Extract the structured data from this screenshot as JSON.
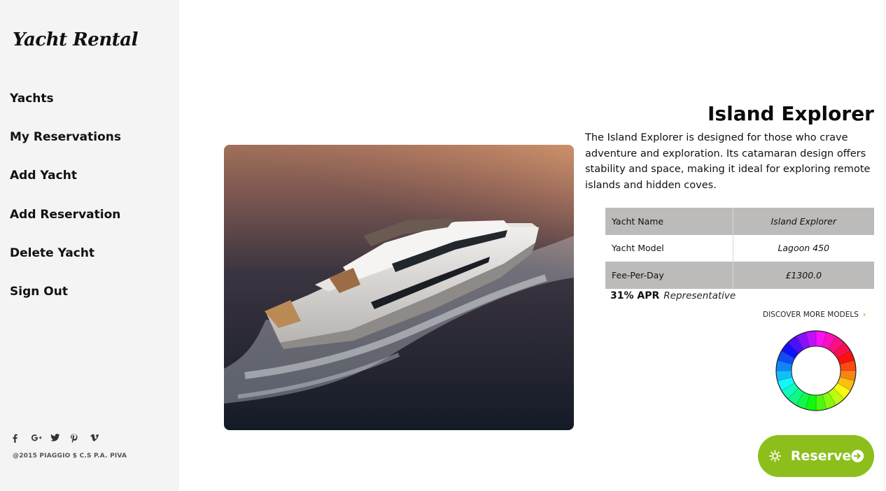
{
  "brand": {
    "logo_text": "Yacht Rental"
  },
  "nav": {
    "items": [
      {
        "label": "Yachts"
      },
      {
        "label": "My Reservations"
      },
      {
        "label": "Add Yacht"
      },
      {
        "label": "Add Reservation"
      },
      {
        "label": "Delete Yacht"
      },
      {
        "label": "Sign Out"
      }
    ]
  },
  "social": {
    "icons": [
      {
        "name": "facebook-icon",
        "glyph": "f"
      },
      {
        "name": "google-plus-icon",
        "glyph": "G+"
      },
      {
        "name": "twitter-icon",
        "glyph": "t"
      },
      {
        "name": "pinterest-icon",
        "glyph": "p"
      },
      {
        "name": "vimeo-icon",
        "glyph": "v"
      }
    ],
    "copyright": "@2015 PIAGGIO $ C.S P.A. PIVA"
  },
  "yacht": {
    "title": "Island Explorer",
    "description": "The Island Explorer is designed for those who crave adventure and exploration. Its catamaran design offers stability and space, making it ideal for exploring remote islands and hidden coves.",
    "image": "yacht-photo",
    "specs": [
      {
        "label": "Yacht Name",
        "value": "Island Explorer"
      },
      {
        "label": "Yacht Model",
        "value": "Lagoon 450"
      },
      {
        "label": "Fee-Per-Day",
        "value": "£1300.0"
      }
    ],
    "apr": {
      "rate": "31% APR",
      "note": "Representative"
    },
    "discover_label": "DISCOVER MORE MODELS",
    "color_wheel_icon": "color-wheel"
  },
  "reserve_button": {
    "label": "Reserve",
    "icon_left": "sun-icon",
    "icon_right": "arrow-circle-right-icon"
  },
  "colors": {
    "accent": "#8cbf1b",
    "table_shade": "#bcbbba",
    "sidebar_bg": "#f4f4f4",
    "discover_chevron": "#e8a000"
  }
}
